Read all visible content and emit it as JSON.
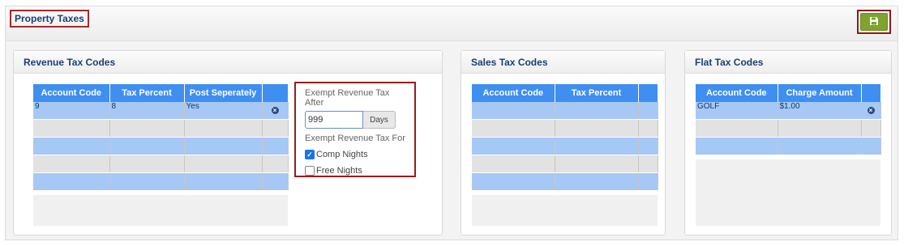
{
  "page": {
    "title": "Property Taxes"
  },
  "toolbar": {
    "save_icon": "floppy-disk-icon"
  },
  "revenue": {
    "title": "Revenue Tax Codes",
    "columns": [
      "Account Code",
      "Tax Percent",
      "Post Seperately"
    ],
    "rows": [
      [
        "9",
        "8",
        "Yes"
      ],
      [
        "",
        "",
        ""
      ],
      [
        "",
        "",
        ""
      ],
      [
        "",
        "",
        ""
      ],
      [
        "",
        "",
        ""
      ]
    ],
    "exempt_after_label": "Exempt Revenue Tax After",
    "exempt_after_value": "999",
    "exempt_after_unit": "Days",
    "exempt_for_label": "Exempt Revenue Tax For",
    "comp_nights_label": "Comp Nights",
    "comp_nights_checked": true,
    "free_nights_label": "Free Nights",
    "free_nights_checked": false
  },
  "sales": {
    "title": "Sales Tax Codes",
    "columns": [
      "Account Code",
      "Tax Percent"
    ],
    "rows": [
      [
        "",
        ""
      ],
      [
        "",
        ""
      ],
      [
        "",
        ""
      ],
      [
        "",
        ""
      ],
      [
        "",
        ""
      ]
    ]
  },
  "flat": {
    "title": "Flat Tax Codes",
    "columns": [
      "Account Code",
      "Charge Amount"
    ],
    "rows": [
      [
        "GOLF",
        "$1.00"
      ],
      [
        "",
        ""
      ],
      [
        "",
        ""
      ]
    ]
  },
  "colors": {
    "header_blue": "#3f8ff0",
    "row_blue": "#a6c8f5",
    "row_grey": "#e2e2e2",
    "save_green": "#7fa32d",
    "highlight_red": "#9b1c1c",
    "title_navy": "#1b3f73"
  }
}
